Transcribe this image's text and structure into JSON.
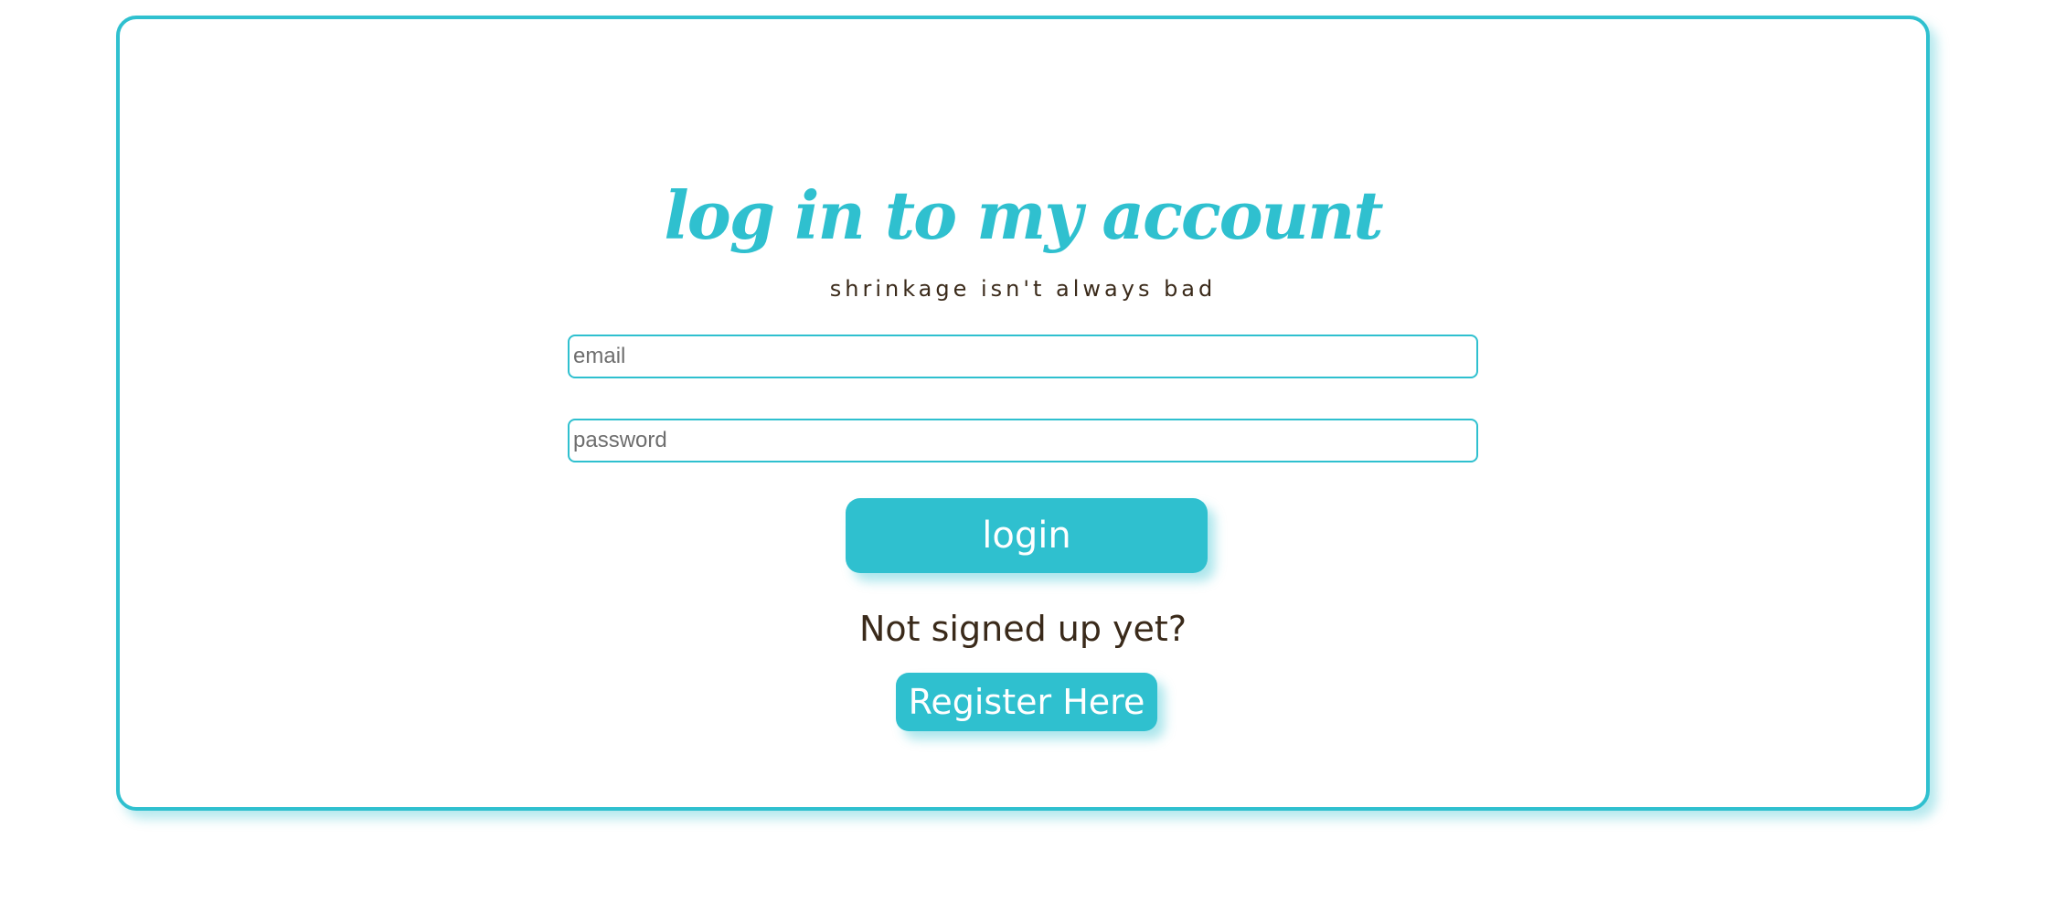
{
  "login_card": {
    "title": "log in to my account",
    "subtitle": "shrinkage isn't always bad",
    "email_placeholder": "email",
    "password_placeholder": "password",
    "login_label": "login",
    "signup_prompt": "Not signed up yet?",
    "register_label": "Register Here"
  },
  "colors": {
    "accent": "#2fc0cf",
    "text_dark": "#3a2a1a",
    "background": "#ffffff"
  }
}
